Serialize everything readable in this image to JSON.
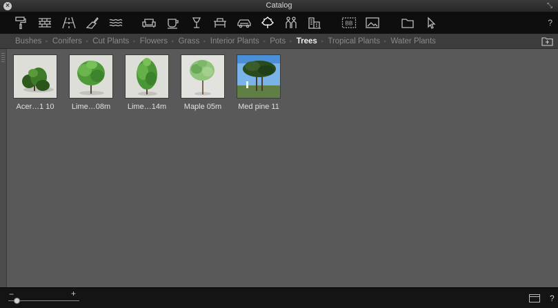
{
  "window": {
    "title": "Catalog",
    "close_label": "×",
    "help_label": "?"
  },
  "toolbar": {
    "tools": [
      {
        "icon": "paint-roller-icon"
      },
      {
        "icon": "brick-wall-icon"
      },
      {
        "icon": "road-icon"
      },
      {
        "icon": "trowel-icon"
      },
      {
        "icon": "water-waves-icon"
      },
      {
        "icon": "sofa-icon"
      },
      {
        "icon": "cup-icon"
      },
      {
        "icon": "lamp-icon"
      },
      {
        "icon": "table-icon"
      },
      {
        "icon": "car-icon"
      },
      {
        "icon": "leaf-icon",
        "active": true
      },
      {
        "icon": "people-icon"
      },
      {
        "icon": "buildings-icon"
      },
      {
        "icon": "billboard-icon"
      },
      {
        "icon": "picture-icon"
      },
      {
        "icon": "folder-icon"
      },
      {
        "icon": "cursor-icon"
      }
    ],
    "billboard_text": "BB"
  },
  "tabs": [
    {
      "label": "Bushes"
    },
    {
      "label": "Conifers"
    },
    {
      "label": "Cut Plants"
    },
    {
      "label": "Flowers"
    },
    {
      "label": "Grass"
    },
    {
      "label": "Interior Plants"
    },
    {
      "label": "Pots"
    },
    {
      "label": "Trees",
      "active": true
    },
    {
      "label": "Tropical Plants"
    },
    {
      "label": "Water Plants"
    }
  ],
  "items": [
    {
      "label": "Acer…1 10"
    },
    {
      "label": "Lime…08m"
    },
    {
      "label": "Lime…14m"
    },
    {
      "label": "Maple 05m"
    },
    {
      "label": "Med pine 11"
    }
  ],
  "statusbar": {
    "zoom_minus": "−",
    "zoom_plus": "+",
    "zoom_level": 0.12,
    "help_label": "?"
  }
}
